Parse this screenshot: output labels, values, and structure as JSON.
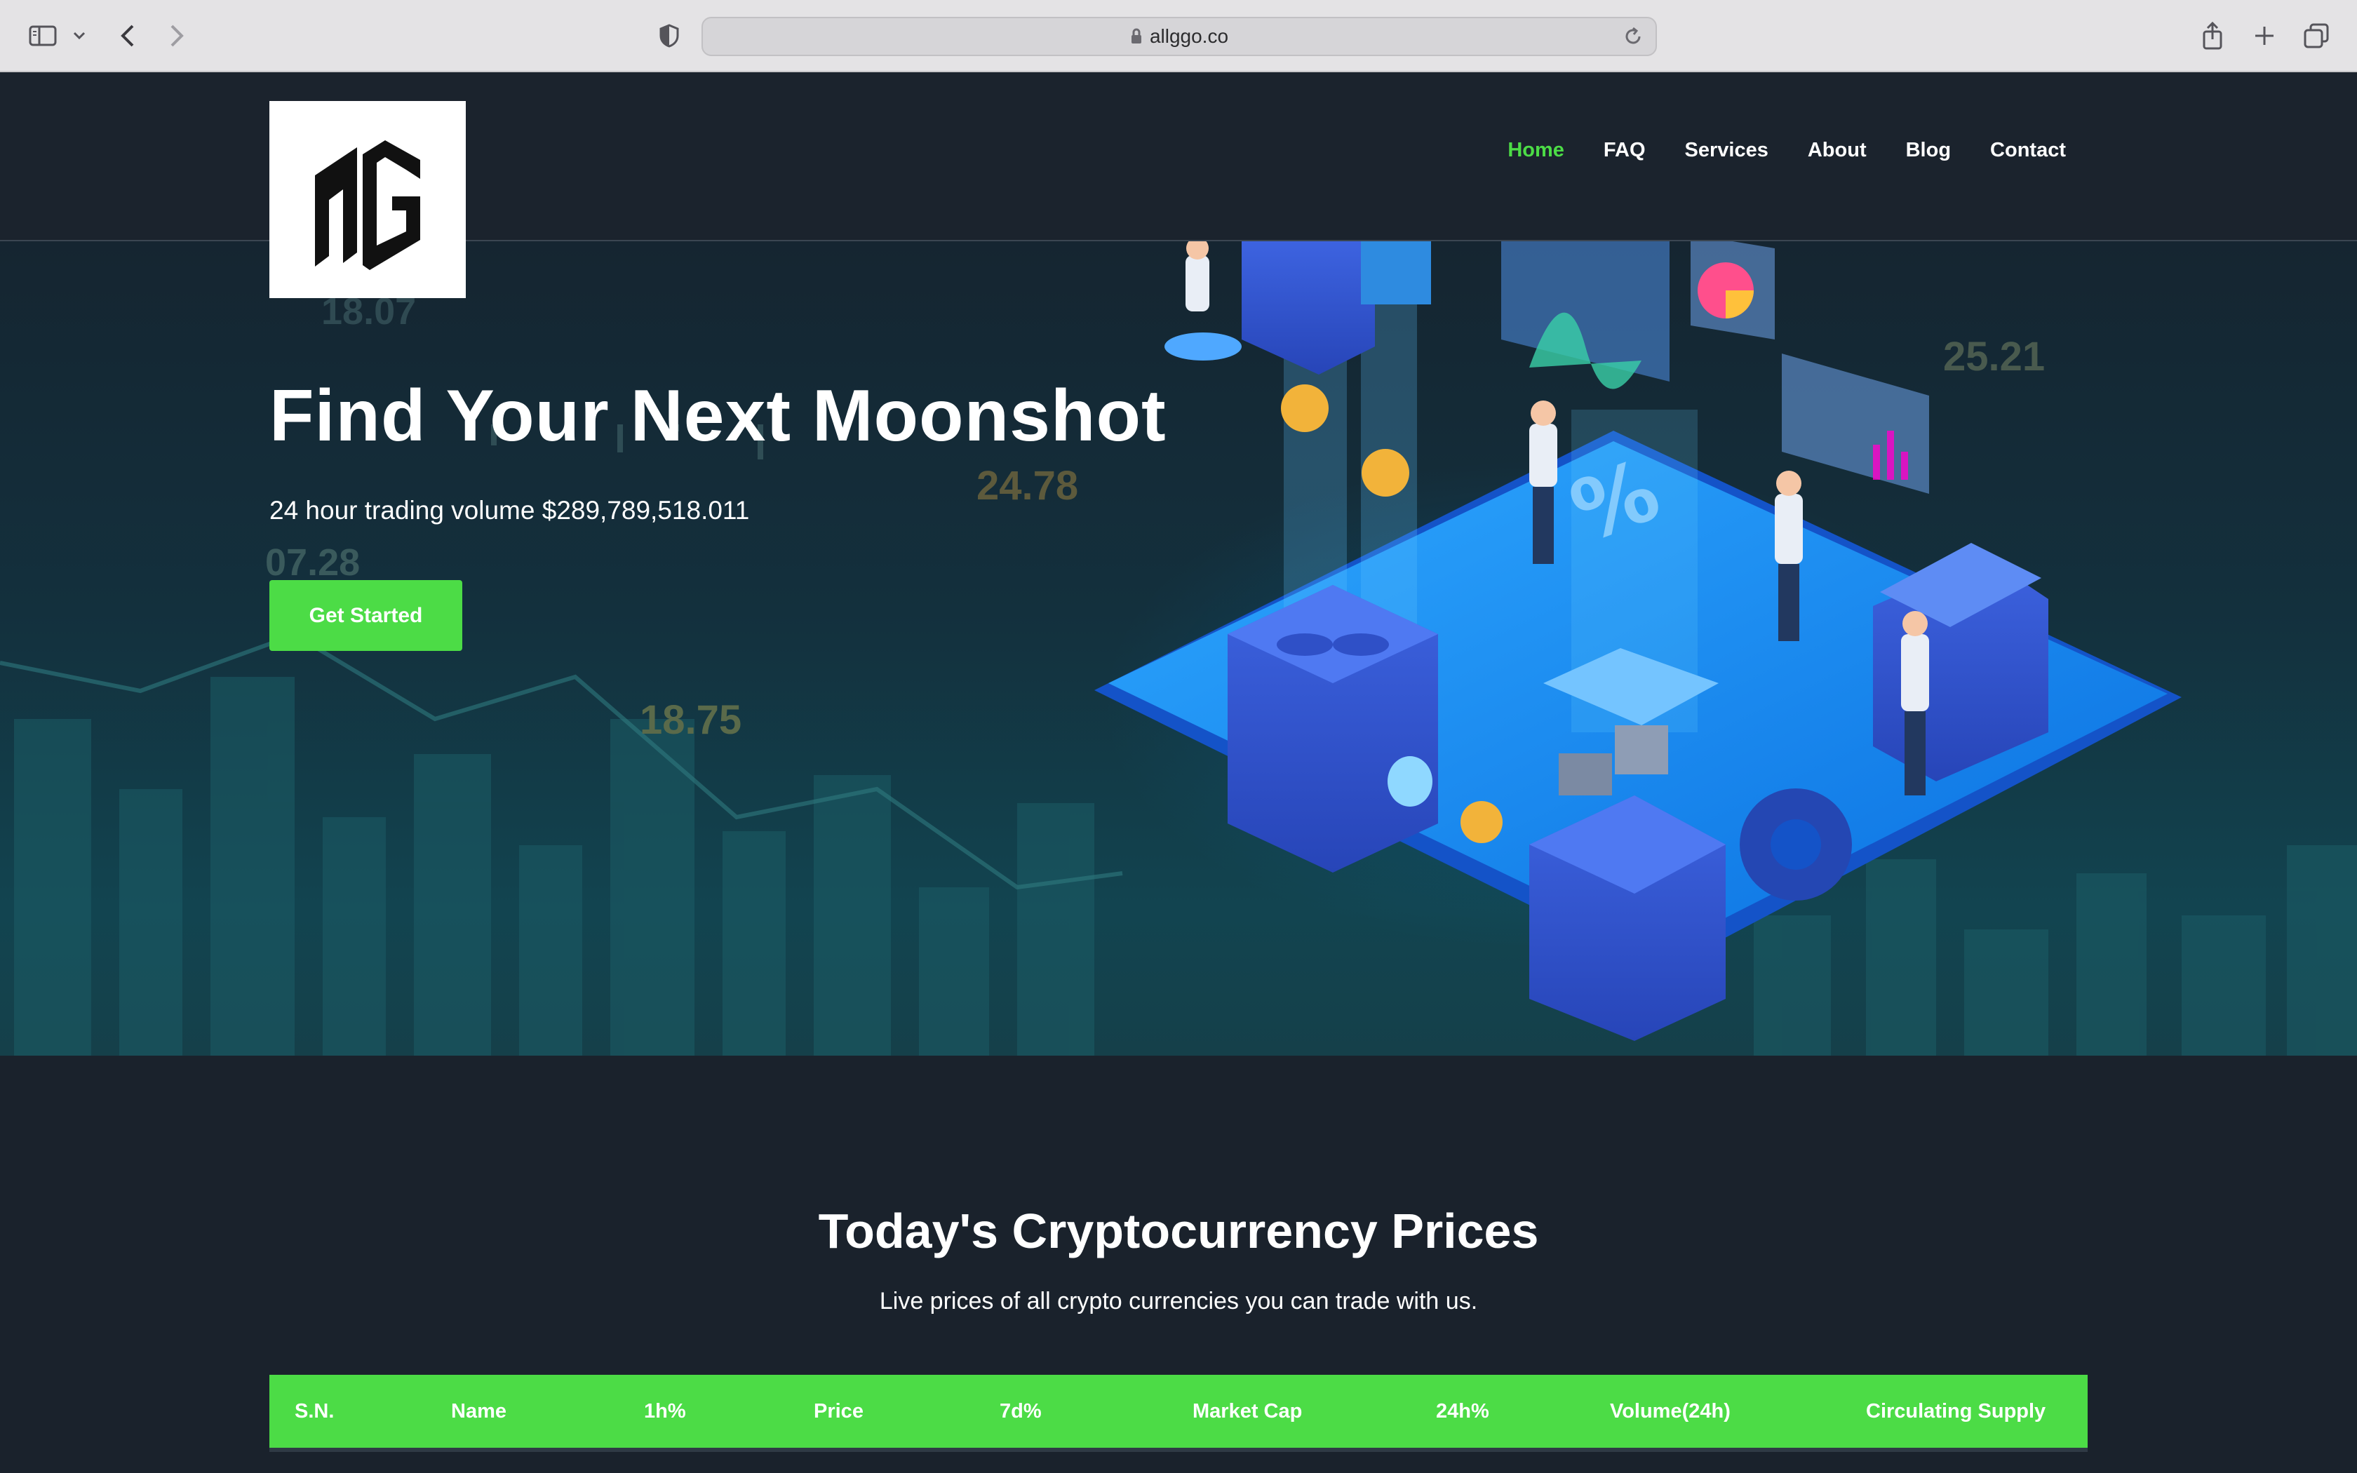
{
  "browser": {
    "url": "allggo.co",
    "icons": [
      "sidebar-icon",
      "chevron-down-icon",
      "back-icon",
      "forward-icon",
      "privacy-shield-icon",
      "lock-icon",
      "reload-icon",
      "share-icon",
      "new-tab-icon",
      "tab-overview-icon"
    ]
  },
  "nav": {
    "items": [
      {
        "label": "Home",
        "active": true
      },
      {
        "label": "FAQ",
        "active": false
      },
      {
        "label": "Services",
        "active": false
      },
      {
        "label": "About",
        "active": false
      },
      {
        "label": "Blog",
        "active": false
      },
      {
        "label": "Contact",
        "active": false
      }
    ],
    "active_color": "#4cdc46"
  },
  "logo": {
    "text": "AG"
  },
  "hero": {
    "title": "Find Your Next Moonshot",
    "subtitle": "24 hour trading volume $289,789,518.011",
    "cta_label": "Get Started",
    "bg_numbers": [
      "18.07",
      "24.78",
      "07.28",
      "18.75",
      "25.21"
    ]
  },
  "prices": {
    "title": "Today's Cryptocurrency Prices",
    "subtitle": "Live prices of all crypto currencies you can trade with us.",
    "columns": [
      "S.N.",
      "Name",
      "1h%",
      "Price",
      "7d%",
      "Market Cap",
      "24h%",
      "Volume(24h)",
      "Circulating Supply"
    ]
  },
  "colors": {
    "accent": "#4cdc46",
    "page_bg": "#1a222c",
    "navbar_bg": "#1b232d"
  }
}
